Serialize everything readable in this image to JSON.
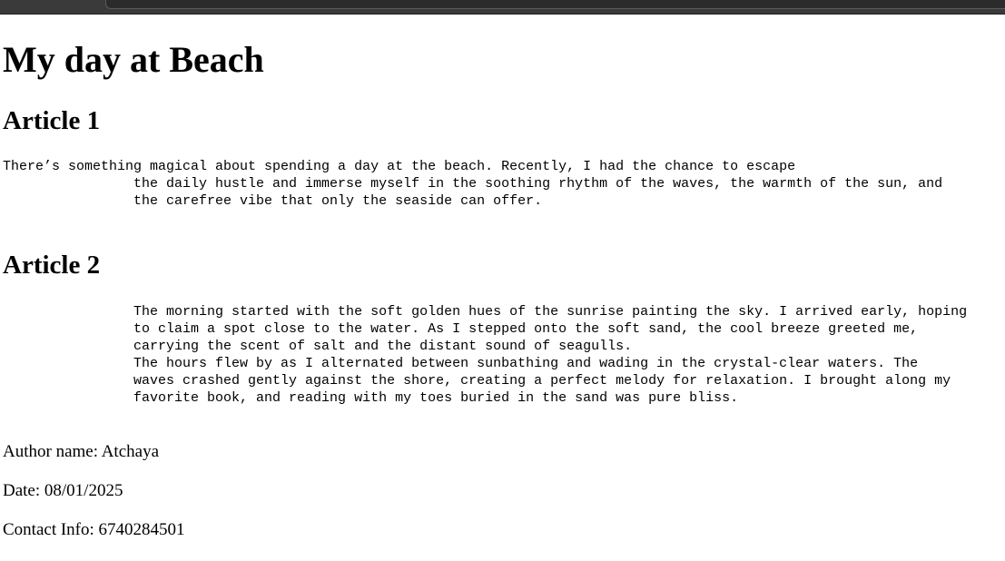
{
  "page": {
    "title": "My day at Beach"
  },
  "articles": [
    {
      "heading": "Article 1",
      "text": "There’s something magical about spending a day at the beach. Recently, I had the chance to escape\n                the daily hustle and immerse myself in the soothing rhythm of the waves, the warmth of the sun, and\n                the carefree vibe that only the seaside can offer."
    },
    {
      "heading": "Article 2",
      "text": "                The morning started with the soft golden hues of the sunrise painting the sky. I arrived early, hoping\n                to claim a spot close to the water. As I stepped onto the soft sand, the cool breeze greeted me,\n                carrying the scent of salt and the distant sound of seagulls.\n                The hours flew by as I alternated between sunbathing and wading in the crystal-clear waters. The\n                waves crashed gently against the shore, creating a perfect melody for relaxation. I brought along my\n                favorite book, and reading with my toes buried in the sand was pure bliss."
    }
  ],
  "footer": {
    "author": "Author name: Atchaya",
    "date": "Date: 08/01/2025",
    "contact": "Contact Info: 6740284501"
  }
}
